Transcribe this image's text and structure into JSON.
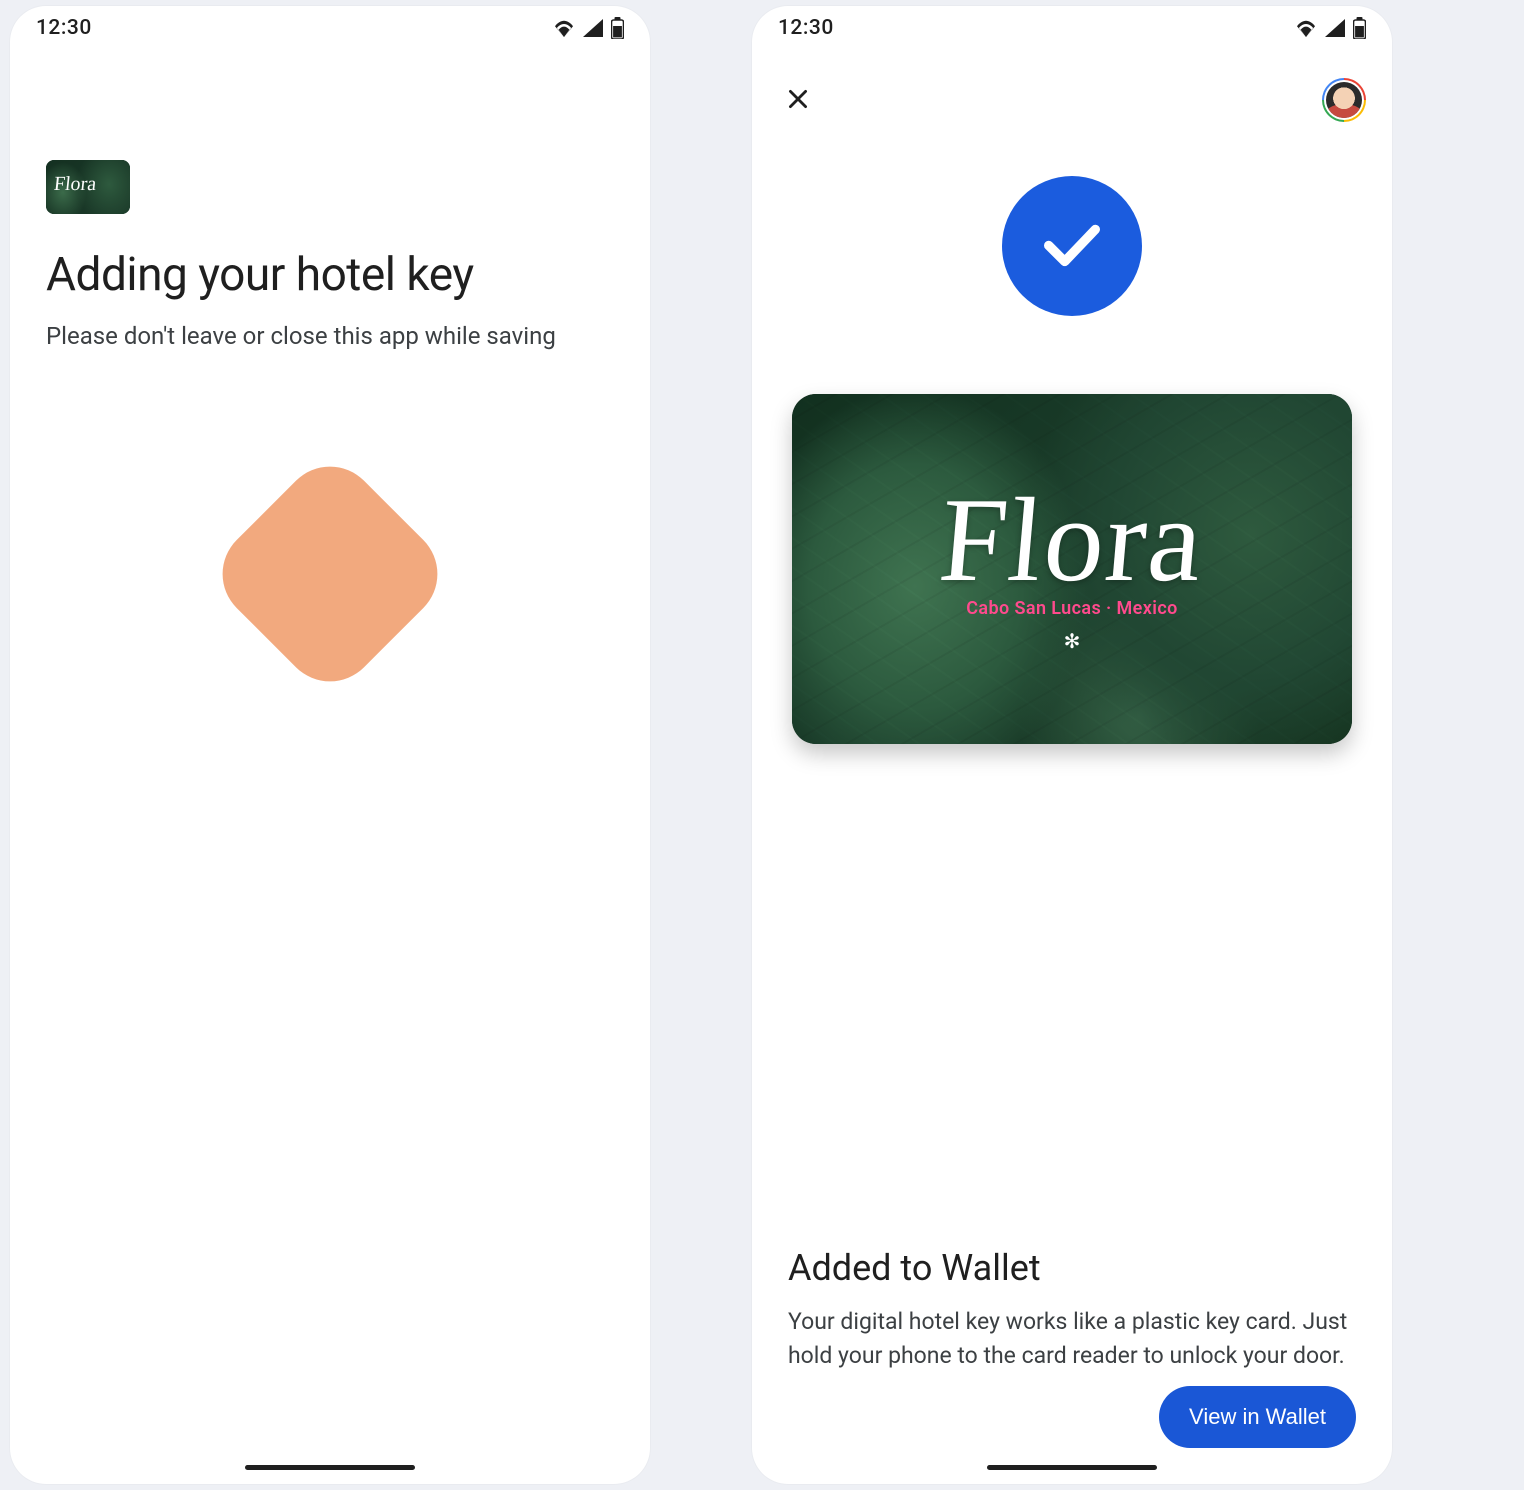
{
  "status": {
    "time": "12:30"
  },
  "left": {
    "card_brand": "Flora",
    "title": "Adding your hotel key",
    "subtitle": "Please don't leave or close this app while saving"
  },
  "right": {
    "card": {
      "brand": "Flora",
      "location": "Cabo San Lucas · Mexico"
    },
    "added_title": "Added to Wallet",
    "added_body": "Your digital hotel key works like a plastic key card. Just hold your phone to the card reader to unlock your door.",
    "button": "View in Wallet"
  }
}
